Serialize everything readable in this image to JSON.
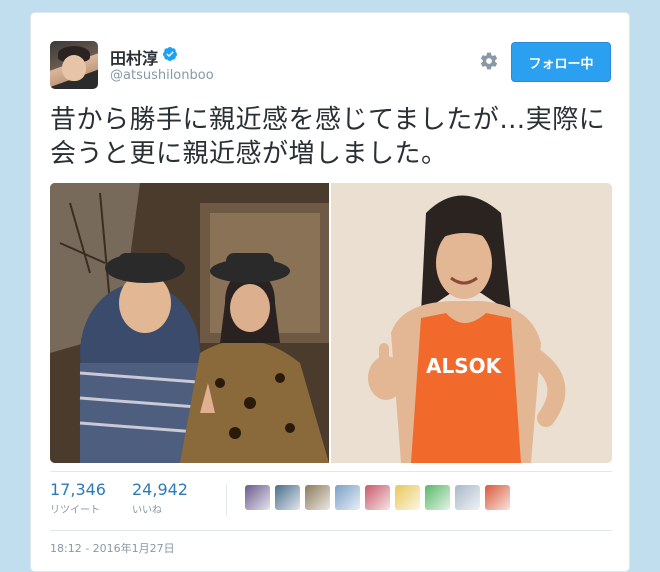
{
  "user": {
    "display_name": "田村淳",
    "handle": "@atsushilonboo",
    "verified": true
  },
  "actions": {
    "settings_icon": "gear-icon",
    "follow_label": "フォロー中"
  },
  "tweet": {
    "text": "昔から勝手に親近感を感じてましたが…実際に会うと更に親近感が増しました。",
    "media_right_text": "ALSOK"
  },
  "stats": {
    "retweets": "17,346",
    "retweets_label": "リツイート",
    "likes": "24,942",
    "likes_label": "いいね"
  },
  "likers": [
    {
      "color": "#6a5a8c"
    },
    {
      "color": "#4a6d8c"
    },
    {
      "color": "#8c7a5a"
    },
    {
      "color": "#7aa0c8"
    },
    {
      "color": "#c85a6a"
    },
    {
      "color": "#e8c85a"
    },
    {
      "color": "#5ab86a"
    },
    {
      "color": "#a8b8c8"
    },
    {
      "color": "#d85a3a"
    }
  ],
  "timestamp": "18:12 - 2016年1月27日",
  "colors": {
    "accent": "#2b9ff0",
    "link": "#2b7bb9",
    "muted": "#8899a6"
  }
}
